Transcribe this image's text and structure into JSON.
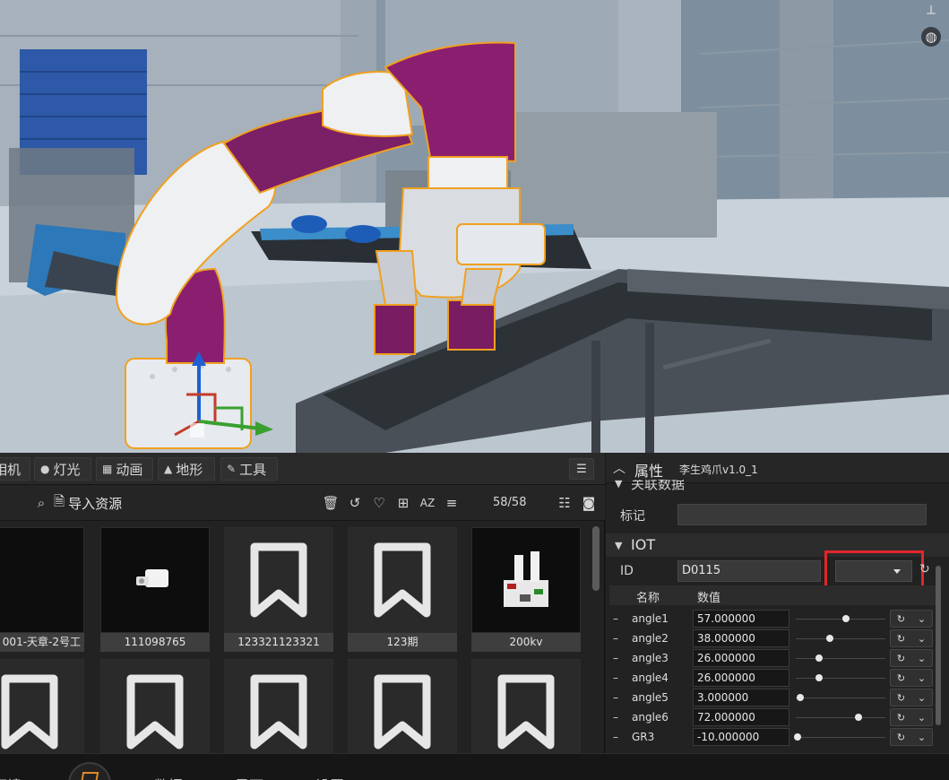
{
  "viewport": {
    "icons": [
      "transform-gizmo-icon",
      "globe-icon"
    ]
  },
  "assets_panel": {
    "tabs": [
      {
        "label": "相机",
        "icon": "camera-icon"
      },
      {
        "label": "灯光",
        "icon": "bulb-icon"
      },
      {
        "label": "动画",
        "icon": "film-icon"
      },
      {
        "label": "地形",
        "icon": "mountain-icon"
      },
      {
        "label": "工具",
        "icon": "wrench-icon"
      }
    ],
    "import_label": "导入资源",
    "count": "58/58",
    "assets": [
      {
        "name": "001-天章-2号工",
        "thumb": "empty"
      },
      {
        "name": "111098765",
        "thumb": "part"
      },
      {
        "name": "123321123321",
        "thumb": "bookmark"
      },
      {
        "name": "123期",
        "thumb": "bookmark"
      },
      {
        "name": "200kv",
        "thumb": "machine"
      }
    ]
  },
  "properties": {
    "title": "属性",
    "object_name": "李生鸡爪v1.0_1",
    "section_partial": "关联数据",
    "tag_label": "标记",
    "tag_value": "",
    "iot_section": "IOT",
    "id_label": "ID",
    "id_value": "D0115",
    "id_select_value": "",
    "table_headers": {
      "name": "名称",
      "value": "数值"
    },
    "params": [
      {
        "name": "angle1",
        "value": "57.000000",
        "level": 0.57
      },
      {
        "name": "angle2",
        "value": "38.000000",
        "level": 0.38
      },
      {
        "name": "angle3",
        "value": "26.000000",
        "level": 0.26
      },
      {
        "name": "angle4",
        "value": "26.000000",
        "level": 0.26
      },
      {
        "name": "angle5",
        "value": "3.000000",
        "level": 0.03
      },
      {
        "name": "angle6",
        "value": "72.000000",
        "level": 0.72
      },
      {
        "name": "GR3",
        "value": "-10.000000",
        "level": 0.0
      }
    ]
  },
  "bottom_nav": {
    "items": [
      "环境",
      "数据",
      "界面",
      "设置"
    ]
  },
  "colors": {
    "robot_purple": "#8a1f70",
    "selection_outline": "#f0a020",
    "highlight_box": "#e3262b"
  }
}
